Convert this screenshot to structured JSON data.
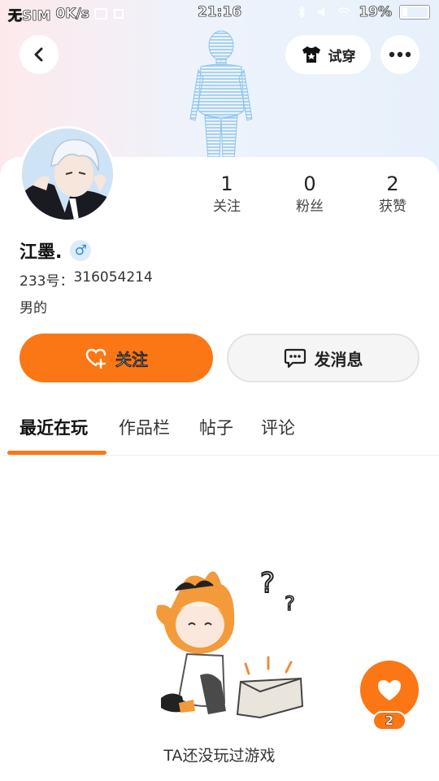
{
  "status_bar": {
    "carrier": "无SIM",
    "speed": "0K/s",
    "time": "21:16",
    "battery": "19%"
  },
  "header": {
    "tryon_label": "试穿"
  },
  "profile": {
    "stats": [
      {
        "value": "1",
        "label": "关注"
      },
      {
        "value": "0",
        "label": "粉丝"
      },
      {
        "value": "2",
        "label": "获赞"
      }
    ],
    "username": "江墨.",
    "gender_symbol": "♂",
    "uid_label": "233号：",
    "uid": "316054214",
    "bio": "男的"
  },
  "actions": {
    "follow_label": "关注",
    "message_label": "发消息"
  },
  "tabs": [
    {
      "label": "最近在玩",
      "active": true
    },
    {
      "label": "作品栏",
      "active": false
    },
    {
      "label": "帖子",
      "active": false
    },
    {
      "label": "评论",
      "active": false
    }
  ],
  "empty_state": {
    "text": "TA还没玩过游戏"
  },
  "like": {
    "count": "2"
  },
  "colors": {
    "accent": "#fb7614",
    "gender": "#2b8ce8"
  }
}
